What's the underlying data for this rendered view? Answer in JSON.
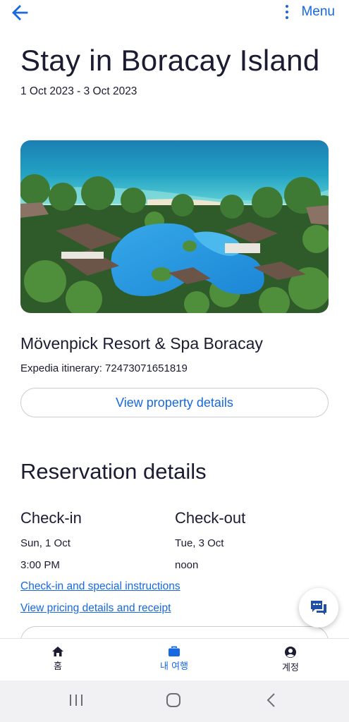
{
  "top_bar": {
    "back_icon": "arrow-left-icon",
    "kebab_icon": "more-vertical-icon",
    "menu_label": "Menu"
  },
  "trip": {
    "title": "Stay in Boracay Island",
    "dates": "1 Oct 2023 - 3 Oct 2023"
  },
  "hotel": {
    "image": "resort-pool-aerial-photo",
    "name": "Mövenpick Resort & Spa Boracay",
    "itinerary": "Expedia itinerary: 72473071651819",
    "view_details_label": "View property details"
  },
  "reservation": {
    "title": "Reservation details",
    "checkin": {
      "label": "Check-in",
      "date": "Sun, 1 Oct",
      "time": "3:00 PM"
    },
    "checkout": {
      "label": "Check-out",
      "date": "Tue, 3 Oct",
      "time": "noon"
    },
    "links": [
      "Check-in and special instructions",
      "View pricing details and receipt"
    ]
  },
  "chat_fab": {
    "icon": "chat-bubbles-icon"
  },
  "bottom_nav": {
    "items": [
      {
        "label": "홈",
        "icon": "home-icon",
        "active": false
      },
      {
        "label": "내 여행",
        "icon": "suitcase-icon",
        "active": true
      },
      {
        "label": "계정",
        "icon": "account-icon",
        "active": false
      }
    ]
  },
  "system_nav": {
    "recents_icon": "recents-icon",
    "home_icon": "home-circle-icon",
    "back_icon": "chevron-left-icon"
  },
  "colors": {
    "accent": "#1668e3",
    "text": "#1b1b32",
    "border": "#c9ccd3",
    "system_bar": "#f1f1f3"
  }
}
